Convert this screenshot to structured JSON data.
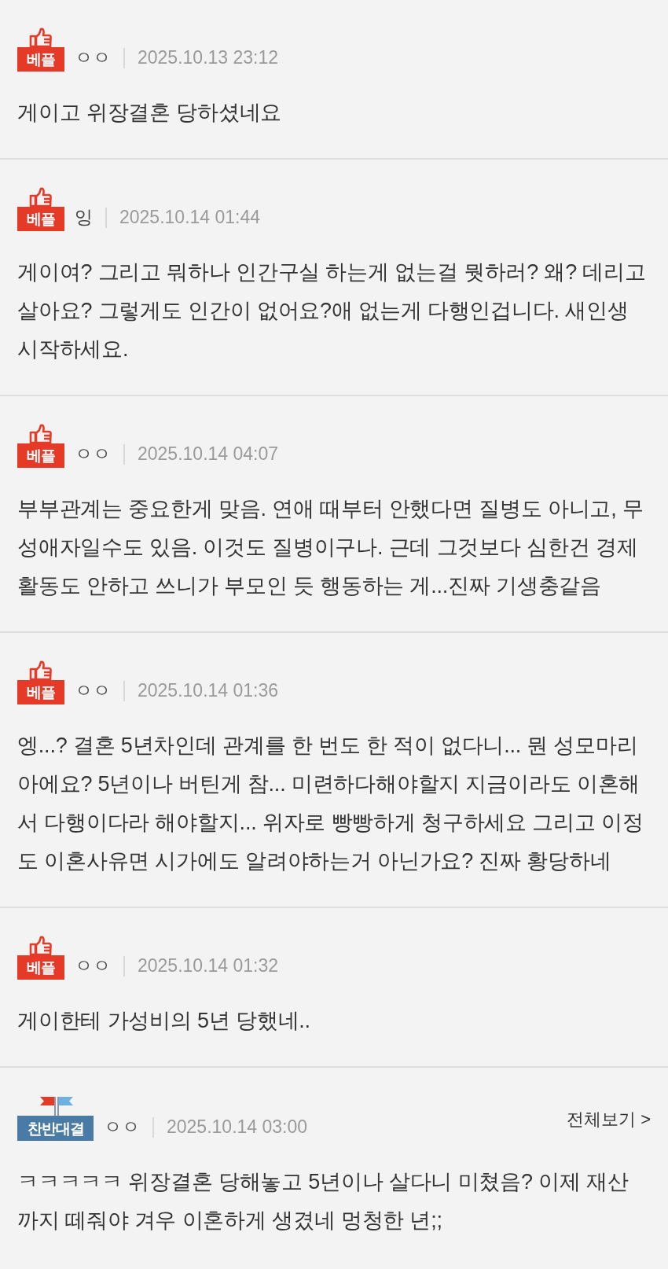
{
  "comments": [
    {
      "badge": {
        "kind": "best",
        "label": "베플"
      },
      "author": "ㅇㅇ",
      "date": "2025.10.13 23:12",
      "text": "게이고 위장결혼 당하셨네요"
    },
    {
      "badge": {
        "kind": "best",
        "label": "베플"
      },
      "author": "잉",
      "date": "2025.10.14 01:44",
      "text": "게이여? 그리고 뭐하나 인간구실 하는게 없는걸 뭣하러? 왜? 데리고 살아요? 그렇게도 인간이 없어요?애 없는게 다행인겁니다. 새인생 시작하세요."
    },
    {
      "badge": {
        "kind": "best",
        "label": "베플"
      },
      "author": "ㅇㅇ",
      "date": "2025.10.14 04:07",
      "text": "부부관계는 중요한게 맞음. 연애 때부터 안했다면 질병도 아니고, 무성애자일수도 있음. 이것도 질병이구나. 근데 그것보다 심한건 경제활동도 안하고 쓰니가 부모인 듯 행동하는 게...진짜 기생충같음"
    },
    {
      "badge": {
        "kind": "best",
        "label": "베플"
      },
      "author": "ㅇㅇ",
      "date": "2025.10.14 01:36",
      "text": "엥...? 결혼 5년차인데 관계를 한 번도 한 적이 없다니... 뭔 성모마리아에요? 5년이나 버틴게 참... 미련하다해야할지 지금이라도 이혼해서 다행이다라 해야할지... 위자로 빵빵하게 청구하세요 그리고 이정도 이혼사유면 시가에도 알려야하는거 아닌가요? 진짜 황당하네"
    },
    {
      "badge": {
        "kind": "best",
        "label": "베플"
      },
      "author": "ㅇㅇ",
      "date": "2025.10.14 01:32",
      "text": "게이한테 가성비의 5년 당했네.."
    },
    {
      "badge": {
        "kind": "versus",
        "label": "찬반대결"
      },
      "author": "ㅇㅇ",
      "date": "2025.10.14 03:00",
      "more_link": "전체보기 >",
      "text": "ㅋㅋㅋㅋㅋ 위장결혼 당해놓고 5년이나 살다니 미쳤음? 이제 재산까지 떼줘야 겨우 이혼하게 생겼네 멍청한 년;;"
    }
  ]
}
